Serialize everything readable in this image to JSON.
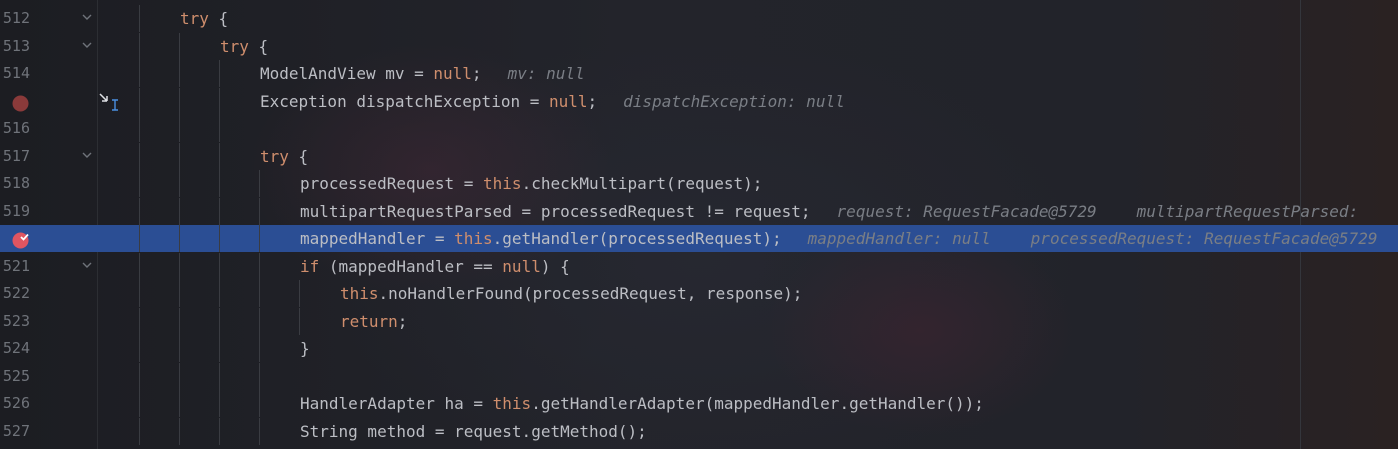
{
  "editor": {
    "lines": [
      {
        "num": "512",
        "fold": true,
        "indent": 2,
        "tokens": [
          {
            "t": "try",
            "k": true
          },
          {
            "t": " {"
          }
        ],
        "hints": []
      },
      {
        "num": "513",
        "fold": true,
        "indent": 3,
        "tokens": [
          {
            "t": "try",
            "k": true
          },
          {
            "t": " {"
          }
        ],
        "hints": []
      },
      {
        "num": "514",
        "indent": 4,
        "tokens": [
          {
            "t": "ModelAndView mv = "
          },
          {
            "t": "null",
            "k": true
          },
          {
            "t": ";"
          }
        ],
        "hints": [
          "mv: null"
        ]
      },
      {
        "num": "",
        "breakpoint": "plain",
        "step_icon": true,
        "indent": 4,
        "tokens": [
          {
            "t": "Exception dispatchException = "
          },
          {
            "t": "null",
            "k": true
          },
          {
            "t": ";"
          }
        ],
        "hints": [
          "dispatchException: null"
        ]
      },
      {
        "num": "516",
        "indent": 4,
        "tokens": [],
        "hints": []
      },
      {
        "num": "517",
        "fold": true,
        "indent": 4,
        "tokens": [
          {
            "t": "try",
            "k": true
          },
          {
            "t": " {"
          }
        ],
        "hints": []
      },
      {
        "num": "518",
        "indent": 5,
        "tokens": [
          {
            "t": "processedRequest = "
          },
          {
            "t": "this",
            "k": true
          },
          {
            "t": ".checkMultipart(request);"
          }
        ],
        "hints": []
      },
      {
        "num": "519",
        "indent": 5,
        "tokens": [
          {
            "t": "multipartRequestParsed = processedRequest != request;"
          }
        ],
        "hints": [
          "request: RequestFacade@5729",
          "multipartRequestParsed:"
        ]
      },
      {
        "num": "",
        "breakpoint": "active",
        "current": true,
        "indent": 5,
        "tokens": [
          {
            "t": "mappedHandler = "
          },
          {
            "t": "this",
            "k": true
          },
          {
            "t": ".getHandler(processedRequest);"
          }
        ],
        "hints": [
          "mappedHandler: null",
          "processedRequest: RequestFacade@5729"
        ]
      },
      {
        "num": "521",
        "fold": true,
        "indent": 5,
        "tokens": [
          {
            "t": "if",
            "k": true
          },
          {
            "t": " (mappedHandler == "
          },
          {
            "t": "null",
            "k": true
          },
          {
            "t": ") {"
          }
        ],
        "hints": []
      },
      {
        "num": "522",
        "indent": 6,
        "tokens": [
          {
            "t": "this",
            "k": true
          },
          {
            "t": ".noHandlerFound(processedRequest, response);"
          }
        ],
        "hints": []
      },
      {
        "num": "523",
        "indent": 6,
        "tokens": [
          {
            "t": "return",
            "k": true
          },
          {
            "t": ";"
          }
        ],
        "hints": []
      },
      {
        "num": "524",
        "indent": 5,
        "tokens": [
          {
            "t": "}"
          }
        ],
        "hints": []
      },
      {
        "num": "525",
        "indent": 5,
        "tokens": [],
        "hints": []
      },
      {
        "num": "526",
        "indent": 5,
        "tokens": [
          {
            "t": "HandlerAdapter ha = "
          },
          {
            "t": "this",
            "k": true
          },
          {
            "t": ".getHandlerAdapter(mappedHandler.getHandler());"
          }
        ],
        "hints": []
      },
      {
        "num": "527",
        "indent": 5,
        "tokens": [
          {
            "t": "String method = request.getMethod();"
          }
        ],
        "hints": []
      }
    ]
  },
  "colors": {
    "keyword": "#cf8e6d",
    "text": "#bcbec4",
    "hint": "#7a7e85",
    "current_line": "#2b4e94",
    "breakpoint_plain": "#8a3a3a",
    "breakpoint_active": "#e05561"
  },
  "icons": {
    "fold": "chevron-down-icon",
    "breakpoint": "breakpoint-icon",
    "step": "step-into-cursor-icon"
  }
}
